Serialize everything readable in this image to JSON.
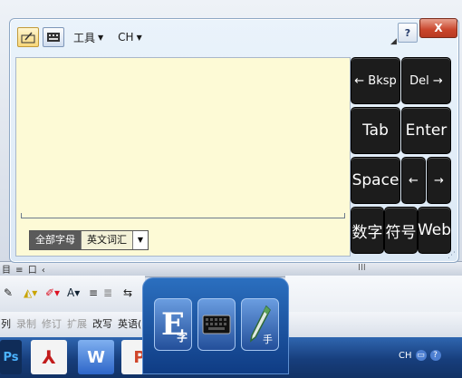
{
  "toolbar": {
    "tools_label": "工具",
    "lang_label": "CH",
    "help_glyph": "?",
    "close_glyph": "X"
  },
  "write_panel": {
    "modes": [
      "全部字母",
      "英文词汇"
    ],
    "selected_mode": "全部字母"
  },
  "keys": {
    "bksp": "← Bksp",
    "del": "Del →",
    "tab": "Tab",
    "enter": "Enter",
    "space": "Space",
    "left": "←",
    "right": "→",
    "digits": "数字",
    "symbols": "符号",
    "web": "Web"
  },
  "background": {
    "menu_items": [
      "列",
      "录制",
      "修订",
      "扩展",
      "改写",
      "英语("
    ],
    "status_marks": "目 ≡ 口 ‹",
    "status_mid": "III",
    "tray_lang": "CH"
  },
  "ime": {
    "e_letter": "E",
    "e_sub": "字",
    "pen_sub": "手"
  }
}
